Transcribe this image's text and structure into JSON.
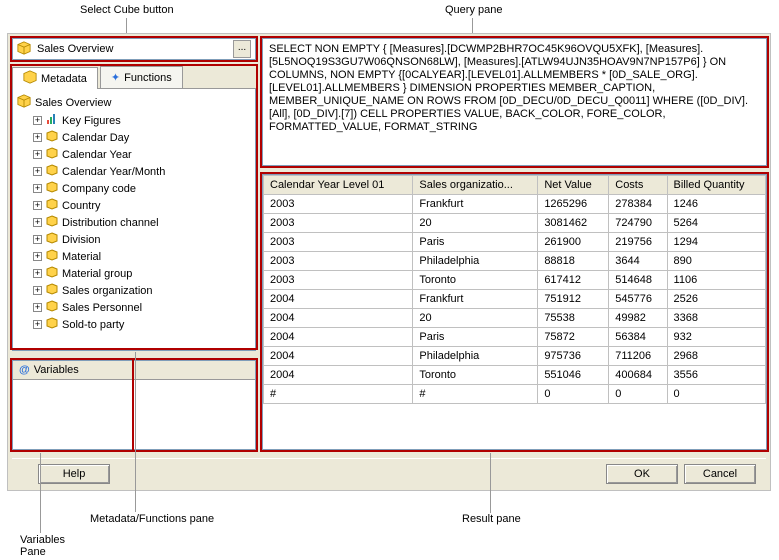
{
  "annotations": {
    "select_cube": "Select Cube button",
    "query_pane": "Query pane",
    "metadata_pane": "Metadata/Functions pane",
    "variables_pane": "Variables\nPane",
    "result_pane": "Result pane"
  },
  "cube": {
    "name": "Sales Overview",
    "more": "..."
  },
  "tabs": {
    "metadata": "Metadata",
    "functions": "Functions"
  },
  "tree": {
    "root": "Sales Overview",
    "items": [
      "Key Figures",
      "Calendar Day",
      "Calendar Year",
      "Calendar Year/Month",
      "Company code",
      "Country",
      "Distribution channel",
      "Division",
      "Material",
      "Material group",
      "Sales organization",
      "Sales Personnel",
      "Sold-to party"
    ]
  },
  "variables": {
    "title": "Variables"
  },
  "query_text": "SELECT NON EMPTY { [Measures].[DCWMP2BHR7OC45K96OVQU5XFK], [Measures].[5L5NOQ19S3GU7W06QNSON68LW], [Measures].[ATLW94UJN35HOAV9N7NP157P6] } ON COLUMNS, NON EMPTY {[0CALYEAR].[LEVEL01].ALLMEMBERS * [0D_SALE_ORG].[LEVEL01].ALLMEMBERS } DIMENSION PROPERTIES MEMBER_CAPTION, MEMBER_UNIQUE_NAME ON ROWS FROM [0D_DECU/0D_DECU_Q0011] WHERE ([0D_DIV].[All], [0D_DIV].[7]) CELL PROPERTIES VALUE, BACK_COLOR, FORE_COLOR, FORMATTED_VALUE, FORMAT_STRING",
  "chart_data": {
    "type": "table",
    "columns": [
      "Calendar Year Level 01",
      "Sales organizatio...",
      "Net Value",
      "Costs",
      "Billed Quantity"
    ],
    "rows": [
      [
        "2003",
        "Frankfurt",
        "1265296",
        "278384",
        "1246"
      ],
      [
        "2003",
        "20",
        "3081462",
        "724790",
        "5264"
      ],
      [
        "2003",
        "Paris",
        "261900",
        "219756",
        "1294"
      ],
      [
        "2003",
        "Philadelphia",
        "88818",
        "3644",
        "890"
      ],
      [
        "2003",
        "Toronto",
        "617412",
        "514648",
        "1106"
      ],
      [
        "2004",
        "Frankfurt",
        "751912",
        "545776",
        "2526"
      ],
      [
        "2004",
        "20",
        "75538",
        "49982",
        "3368"
      ],
      [
        "2004",
        "Paris",
        "75872",
        "56384",
        "932"
      ],
      [
        "2004",
        "Philadelphia",
        "975736",
        "711206",
        "2968"
      ],
      [
        "2004",
        "Toronto",
        "551046",
        "400684",
        "3556"
      ],
      [
        "#",
        "#",
        "0",
        "0",
        "0"
      ]
    ]
  },
  "buttons": {
    "help": "Help",
    "ok": "OK",
    "cancel": "Cancel"
  }
}
